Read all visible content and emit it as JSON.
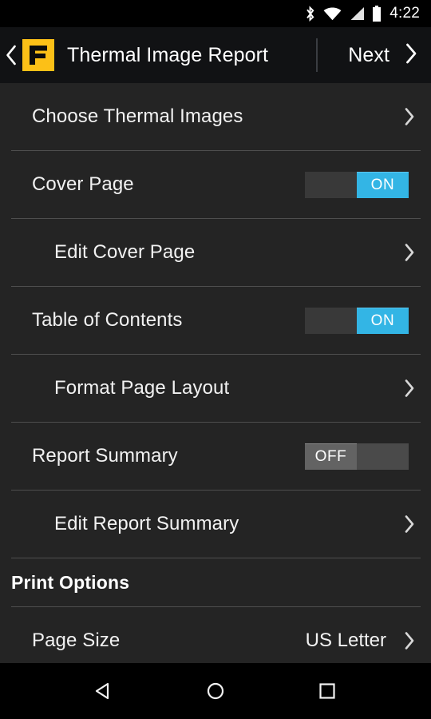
{
  "statusbar": {
    "time": "4:22",
    "icons": [
      "bluetooth-icon",
      "wifi-icon",
      "cellular-signal-icon",
      "battery-icon"
    ]
  },
  "appbar": {
    "back_icon": "back-chevron-icon",
    "logo": "fluke-logo",
    "title": "Thermal Image Report",
    "next_label": "Next",
    "next_icon": "forward-chevron-icon"
  },
  "colors": {
    "accent_blue": "#33b5e5",
    "brand_yellow": "#FCC017",
    "content_bg": "#242424",
    "appbar_bg": "#111214",
    "divider": "#4e4e4e",
    "toggle_off_thumb": "#636363"
  },
  "list": {
    "rows": [
      {
        "label": "Choose Thermal Images",
        "type": "chevron",
        "indent": false
      },
      {
        "label": "Cover Page",
        "type": "toggle",
        "state": "ON",
        "indent": false
      },
      {
        "label": "Edit Cover Page",
        "type": "chevron",
        "indent": true
      },
      {
        "label": "Table of Contents",
        "type": "toggle",
        "state": "ON",
        "indent": false
      },
      {
        "label": "Format Page Layout",
        "type": "chevron",
        "indent": true
      },
      {
        "label": "Report Summary",
        "type": "toggle",
        "state": "OFF",
        "indent": false
      },
      {
        "label": "Edit Report Summary",
        "type": "chevron",
        "indent": true
      }
    ],
    "section": {
      "title": "Print Options"
    },
    "print_rows": [
      {
        "label": "Page Size",
        "value": "US Letter",
        "type": "chevron-value",
        "indent": false
      }
    ]
  },
  "navbar": {
    "back": "nav-back-icon",
    "home": "nav-home-icon",
    "recents": "nav-recents-icon"
  }
}
